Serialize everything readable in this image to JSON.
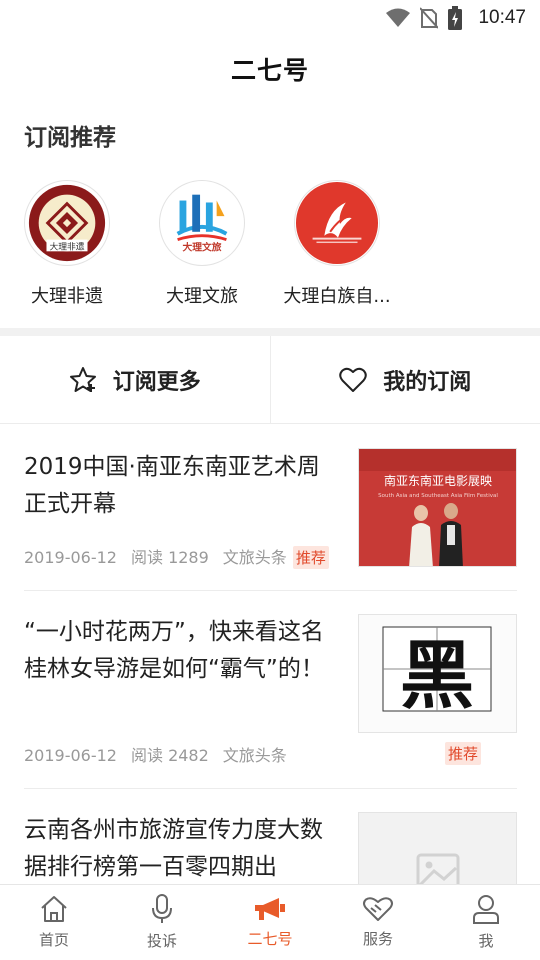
{
  "status_bar": {
    "time": "10:47"
  },
  "header": {
    "title": "二七号"
  },
  "subscribe": {
    "section_title": "订阅推荐",
    "items": [
      {
        "name": "大理非遗",
        "logo_text": "大理非遗"
      },
      {
        "name": "大理文旅",
        "logo_text": "大理文旅"
      },
      {
        "name": "大理白族自..."
      }
    ]
  },
  "actions": {
    "more_label": "订阅更多",
    "mine_label": "我的订阅"
  },
  "articles": [
    {
      "title": "2019中国·南亚东南亚艺术周正式开幕",
      "date": "2019-06-12",
      "reads": "阅读 1289",
      "source": "文旅头条",
      "tag": "推荐",
      "thumb_text": "南亚东南亚电影展映",
      "thumb_subtext": "South Asia and Southeast Asia Film Festival"
    },
    {
      "title": "“一小时花两万”，快来看这名桂林女导游是如何“霸气”的！",
      "date": "2019-06-12",
      "reads": "阅读 2482",
      "source": "文旅头条",
      "tag": "推荐",
      "thumb_char": "黑"
    },
    {
      "title": "云南各州市旅游宣传力度大数据排行榜第一百零四期出"
    }
  ],
  "tabs": [
    {
      "label": "首页",
      "icon": "home-icon"
    },
    {
      "label": "投诉",
      "icon": "microphone-icon"
    },
    {
      "label": "二七号",
      "icon": "megaphone-icon",
      "active": true
    },
    {
      "label": "服务",
      "icon": "handshake-icon"
    },
    {
      "label": "我",
      "icon": "person-icon"
    }
  ],
  "colors": {
    "accent": "#e85b2a",
    "tag_text": "#e14a2c",
    "tag_bg": "#fde5de"
  }
}
